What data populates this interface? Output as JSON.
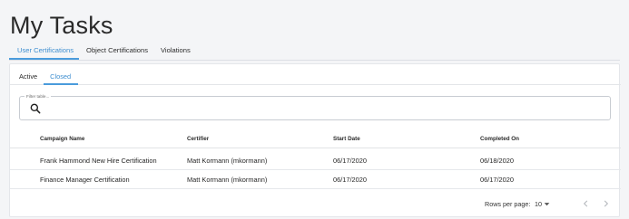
{
  "page": {
    "title": "My Tasks"
  },
  "main_tabs": [
    {
      "label": "User Certifications",
      "active": true
    },
    {
      "label": "Object Certifications",
      "active": false
    },
    {
      "label": "Violations",
      "active": false
    }
  ],
  "sub_tabs": [
    {
      "label": "Active",
      "active": false
    },
    {
      "label": "Closed",
      "active": true
    }
  ],
  "filter": {
    "label": "Filter table...",
    "value": "",
    "icon": "search-icon"
  },
  "table": {
    "columns": [
      "Campaign Name",
      "Certifier",
      "Start Date",
      "Completed On"
    ],
    "rows": [
      [
        "Frank Hammond New Hire Certification",
        "Matt Kormann (mkormann)",
        "06/17/2020",
        "06/18/2020"
      ],
      [
        "Finance Manager Certification",
        "Matt Kormann (mkormann)",
        "06/17/2020",
        "06/17/2020"
      ]
    ]
  },
  "pagination": {
    "rows_per_page_label": "Rows per page:",
    "rows_per_page_value": "10",
    "icons": {
      "caret": "caret-down-icon",
      "prev": "chevron-left-icon",
      "next": "chevron-right-icon"
    }
  },
  "colors": {
    "accent": "#4a9bdc",
    "background": "#f4f5f7",
    "panel": "#ffffff"
  }
}
